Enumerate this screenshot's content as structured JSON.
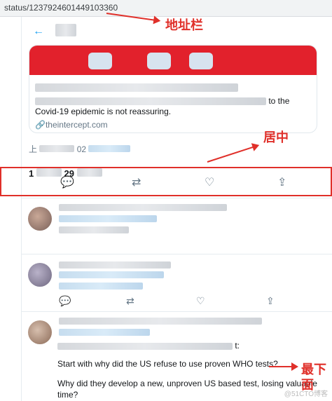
{
  "address_bar": {
    "url": "status/1237924601449103360"
  },
  "tweet": {
    "card_text": "to the",
    "card_text_2": "Covid-19 epidemic is not reassuring.",
    "card_source": "theintercept.com",
    "meta_prefix": "上",
    "meta_mid": "02",
    "stat_1": "1",
    "stat_2": "29"
  },
  "replies": [
    {},
    {},
    {
      "text_suffix": "t:",
      "text_1": "Start with why did the US refuse to use proven WHO tests?",
      "text_2": "Why did they develop a new, unproven US based test, losing valuable time?"
    }
  ],
  "annotations": {
    "address": "地址栏",
    "center": "居中",
    "bottom": "最下面"
  },
  "icons": [
    "back-arrow-icon",
    "reply-icon",
    "retweet-icon",
    "like-icon",
    "share-icon",
    "link-icon"
  ],
  "colors": {
    "accent": "#1da1f2",
    "annotation": "#e0302a",
    "card_image": "#e2212c"
  }
}
